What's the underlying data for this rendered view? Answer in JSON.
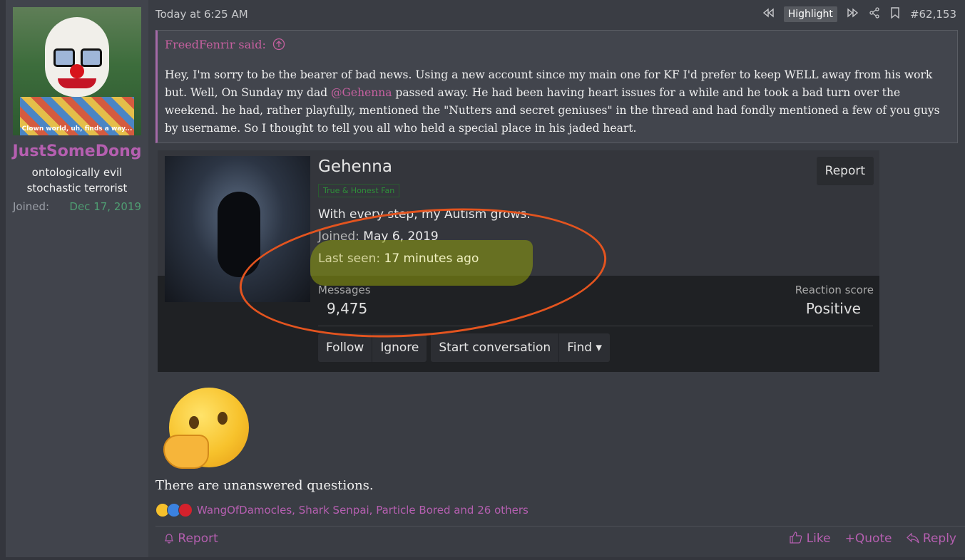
{
  "user": {
    "avatar_caption": "Clown world, uh, finds a way...",
    "name": "JustSomeDong",
    "title_line1": "ontologically evil",
    "title_line2": "stochastic terrorist",
    "joined_label": "Joined:",
    "joined_date": "Dec 17, 2019"
  },
  "post": {
    "date": "Today at 6:25 AM",
    "highlight_label": "Highlight",
    "post_number": "#62,153",
    "text": "There are unanswered questions."
  },
  "quote": {
    "source": "FreedFenrir said:",
    "body_before": "Hey, I'm sorry to be the bearer of bad news. Using a new account since my main one for KF I'd prefer to keep WELL away from his work but. Well, On Sunday my dad ",
    "mention": "@Gehenna",
    "body_after": " passed away. He had been having heart issues for a while and he took a bad turn over the weekend. he had, rather playfully, mentioned the \"Nutters and secret geniuses\" in the thread and had fondly mentioned a few of you guys by username. So I thought to tell you all who held a special place in his jaded heart."
  },
  "embed": {
    "name": "Gehenna",
    "badge": "True & Honest Fan",
    "status": "With every step, my Autism grows.",
    "joined_label": "Joined:",
    "joined_value": "May 6, 2019",
    "last_seen_label": "Last seen:",
    "last_seen_value": "17 minutes ago",
    "report_label": "Report",
    "messages_label": "Messages",
    "messages_value": "9,475",
    "reaction_label": "Reaction score",
    "reaction_value": "Positive",
    "btn_follow": "Follow",
    "btn_ignore": "Ignore",
    "btn_start": "Start conversation",
    "btn_find": "Find ▾"
  },
  "reactions": {
    "users": "WangOfDamocles, Shark Senpai, Particle Bored and 26 others"
  },
  "footer": {
    "report": "Report",
    "like": "Like",
    "quote": "Quote",
    "reply": "Reply"
  },
  "icons": [
    "rewind-icon",
    "fast-forward-icon",
    "share-icon",
    "bookmark-icon",
    "arrow-up-circle-icon",
    "bell-icon",
    "thumbs-up-icon",
    "plus-icon",
    "reply-icon",
    "thinking-face-emoji"
  ]
}
